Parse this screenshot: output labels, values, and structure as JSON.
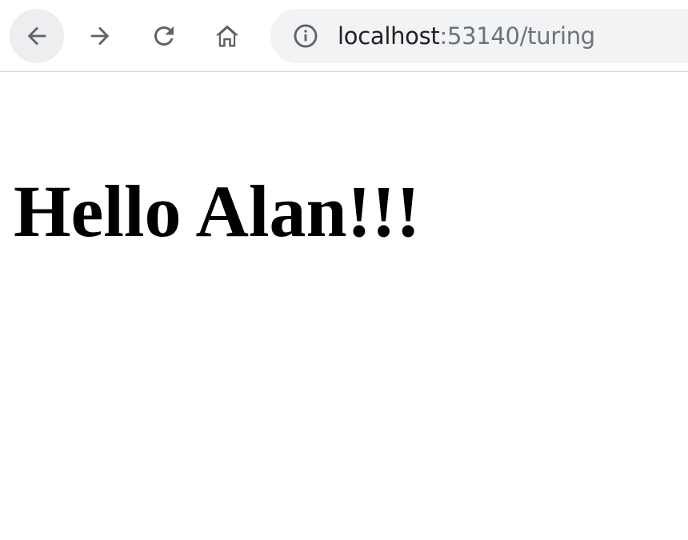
{
  "browser": {
    "address_bar": {
      "host": "localhost",
      "rest": ":53140/turing"
    },
    "icons": {
      "back": "back-arrow-icon",
      "forward": "forward-arrow-icon",
      "reload": "reload-icon",
      "home": "home-icon",
      "info": "info-icon"
    },
    "colors": {
      "toolbar_bg": "#ffffff",
      "omnibox_bg": "#f1f3f4",
      "icon": "#5f6368"
    }
  },
  "page": {
    "heading": "Hello Alan!!!"
  }
}
